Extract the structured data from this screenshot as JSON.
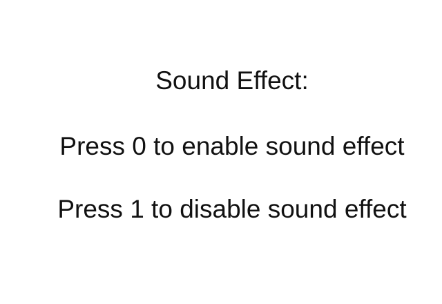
{
  "screen": {
    "title": "Sound Effect:",
    "options": [
      {
        "label": "Press 0 to enable sound effect"
      },
      {
        "label": "Press 1 to disable sound effect"
      }
    ]
  }
}
